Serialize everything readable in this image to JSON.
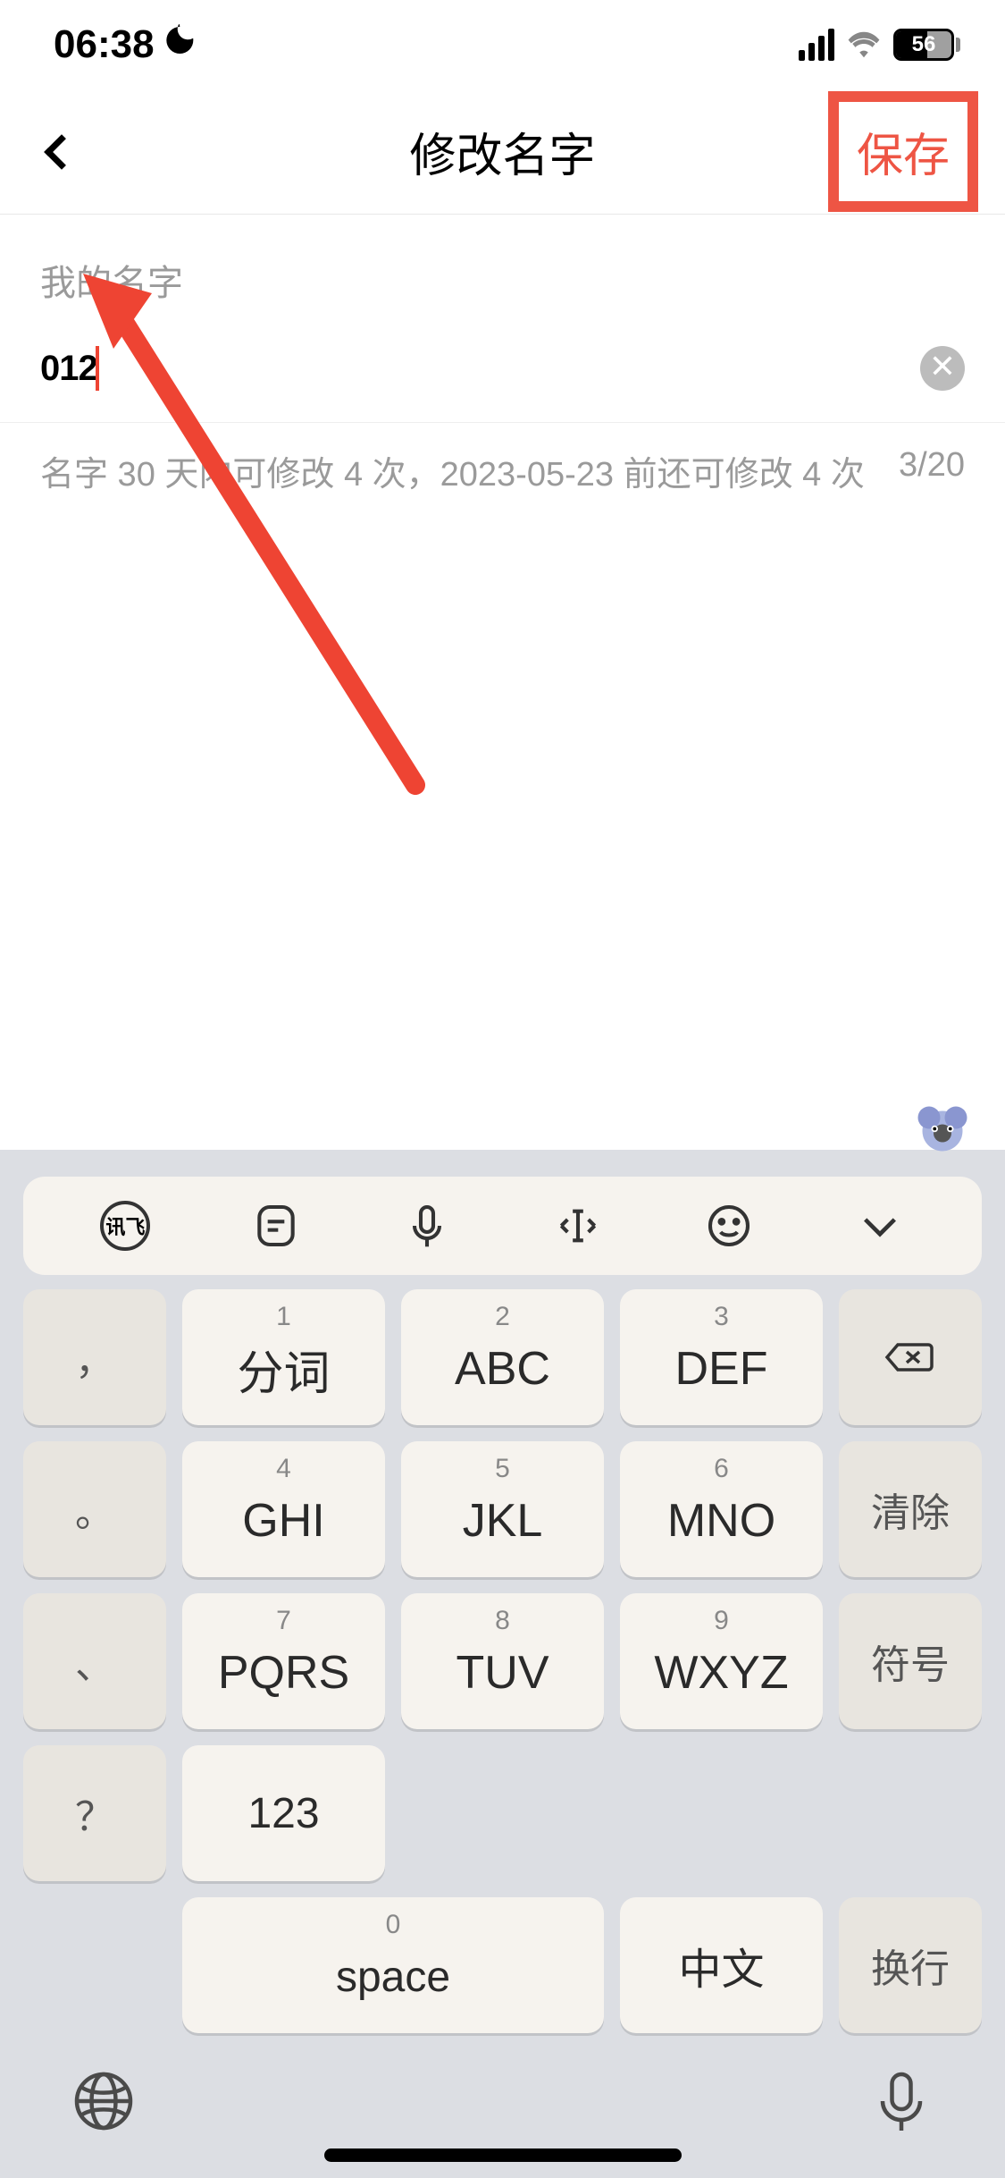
{
  "status": {
    "time": "06:38",
    "battery": "56"
  },
  "header": {
    "title": "修改名字",
    "save": "保存"
  },
  "form": {
    "label": "我的名字",
    "value": "012",
    "hint": "名字 30 天内可修改 4 次，2023-05-23 前还可修改 4 次",
    "counter": "3/20"
  },
  "keyboard": {
    "toolbar_brand": "讯飞",
    "rows": [
      [
        {
          "side": true,
          "label": "，"
        },
        {
          "digit": "1",
          "label": "分词"
        },
        {
          "digit": "2",
          "label": "ABC"
        },
        {
          "digit": "3",
          "label": "DEF"
        },
        {
          "side": true,
          "icon": "backspace"
        }
      ],
      [
        {
          "side": true,
          "label": "。"
        },
        {
          "digit": "4",
          "label": "GHI"
        },
        {
          "digit": "5",
          "label": "JKL"
        },
        {
          "digit": "6",
          "label": "MNO"
        },
        {
          "side": true,
          "label": "清除"
        }
      ],
      [
        {
          "side": true,
          "label": "、"
        },
        {
          "digit": "7",
          "label": "PQRS"
        },
        {
          "digit": "8",
          "label": "TUV"
        },
        {
          "digit": "9",
          "label": "WXYZ"
        },
        {
          "side": true,
          "label": "符号"
        }
      ],
      [
        {
          "side": true,
          "label": "？"
        },
        {
          "label": "123"
        },
        {
          "digit": "0",
          "label": "space",
          "space": true
        },
        {
          "label": "中文"
        },
        {
          "side": true,
          "label": "换行"
        }
      ]
    ]
  }
}
